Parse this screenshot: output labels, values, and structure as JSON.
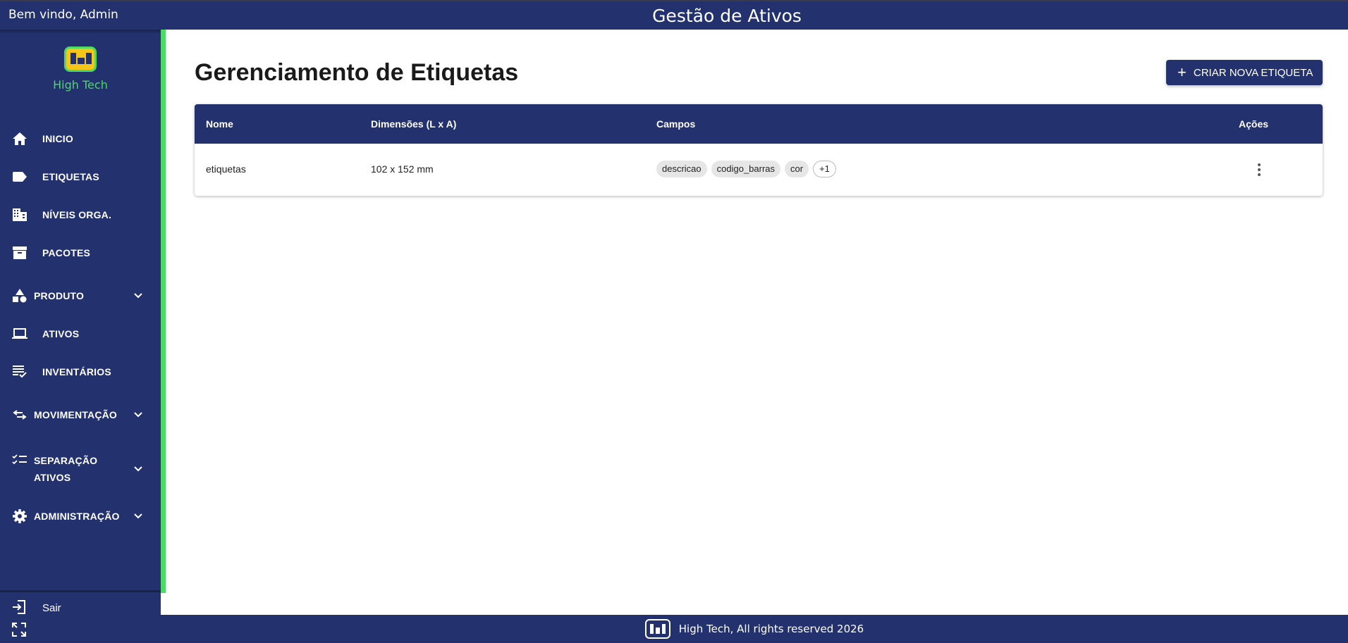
{
  "header": {
    "welcome": "Bem vindo, Admin",
    "title": "Gestão de Ativos"
  },
  "brand": {
    "name": "High Tech",
    "accent_color": "#4cd964",
    "primary_color": "#23316e"
  },
  "sidebar": {
    "items": [
      {
        "label": "INICIO",
        "icon": "home-icon"
      },
      {
        "label": "ETIQUETAS",
        "icon": "label-icon"
      },
      {
        "label": "NÍVEIS ORGA.",
        "icon": "building-icon"
      },
      {
        "label": "PACOTES",
        "icon": "archive-icon"
      },
      {
        "label": "PRODUTO",
        "icon": "shapes-icon",
        "expandable": true
      },
      {
        "label": "ATIVOS",
        "icon": "laptop-icon"
      },
      {
        "label": "INVENTÁRIOS",
        "icon": "list-check-icon"
      },
      {
        "label": "MOVIMENTAÇÃO",
        "icon": "swap-icon",
        "expandable": true
      },
      {
        "label_line1": "SEPARAÇÃO",
        "label_line2": "ATIVOS",
        "icon": "checklist-icon",
        "expandable": true
      },
      {
        "label": "ADMINISTRAÇÃO",
        "icon": "gear-icon",
        "expandable": true
      }
    ],
    "logout": "Sair"
  },
  "main": {
    "title": "Gerenciamento de Etiquetas",
    "create_button": "CRIAR NOVA ETIQUETA",
    "table": {
      "headers": [
        "Nome",
        "Dimensões (L x A)",
        "Campos",
        "Ações"
      ],
      "rows": [
        {
          "nome": "etiquetas",
          "dimensoes": "102 x 152 mm",
          "campos": [
            "descricao",
            "codigo_barras",
            "cor"
          ],
          "extra": "+1"
        }
      ]
    }
  },
  "footer": {
    "text": "High Tech, All rights reserved 2026"
  }
}
